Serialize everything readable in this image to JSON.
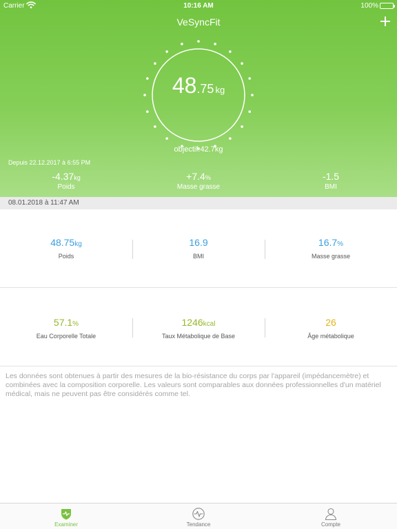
{
  "status_bar": {
    "carrier": "Carrier",
    "time": "10:16 AM",
    "battery": "100%"
  },
  "header": {
    "title": "VeSyncFit"
  },
  "dial": {
    "weight_int": "48",
    "weight_dec": ".75",
    "unit": "kg",
    "objective": "objectif:42.7kg"
  },
  "summary": {
    "since": "Depuis 22.12.2017 à 6:55 PM",
    "deltas": [
      {
        "value": "-4.37",
        "unit": "kg",
        "label": "Poids"
      },
      {
        "value": "+7.4",
        "unit": "%",
        "label": "Masse grasse"
      },
      {
        "value": "-1.5",
        "unit": "",
        "label": "BMI"
      }
    ]
  },
  "measurement_date": "08.01.2018 à 11:47 AM",
  "metrics_row1": [
    {
      "value": "48.75",
      "unit": "kg",
      "label": "Poids"
    },
    {
      "value": "16.9",
      "unit": "",
      "label": "BMI"
    },
    {
      "value": "16.7",
      "unit": "%",
      "label": "Masse grasse"
    }
  ],
  "metrics_row2": [
    {
      "value": "57.1",
      "unit": "%",
      "label": "Eau Corporelle Totale"
    },
    {
      "value": "1246",
      "unit": "kcal",
      "label": "Taux Métabolique de Base"
    },
    {
      "value": "26",
      "unit": "",
      "label": "Âge métabolique"
    }
  ],
  "disclaimer": "Les données sont obtenues à partir des mesures de la bio-résistance du corps par l'appareil (impédancemètre) et combinées avec la composition corporelle. Les valeurs sont comparables aux données professionnelles d'un matériel médical, mais ne peuvent pas être considérés comme tel.",
  "tabs": [
    {
      "label": "Examiner",
      "icon": "shield-icon",
      "active": true
    },
    {
      "label": "Tendance",
      "icon": "pulse-icon",
      "active": false
    },
    {
      "label": "Compte",
      "icon": "user-icon",
      "active": false
    }
  ],
  "colors": {
    "brand_green": "#72c43f",
    "metric_blue": "#3a9fe0",
    "metric_yellow_green": "#96b82a",
    "metric_gold": "#e0b41a"
  }
}
